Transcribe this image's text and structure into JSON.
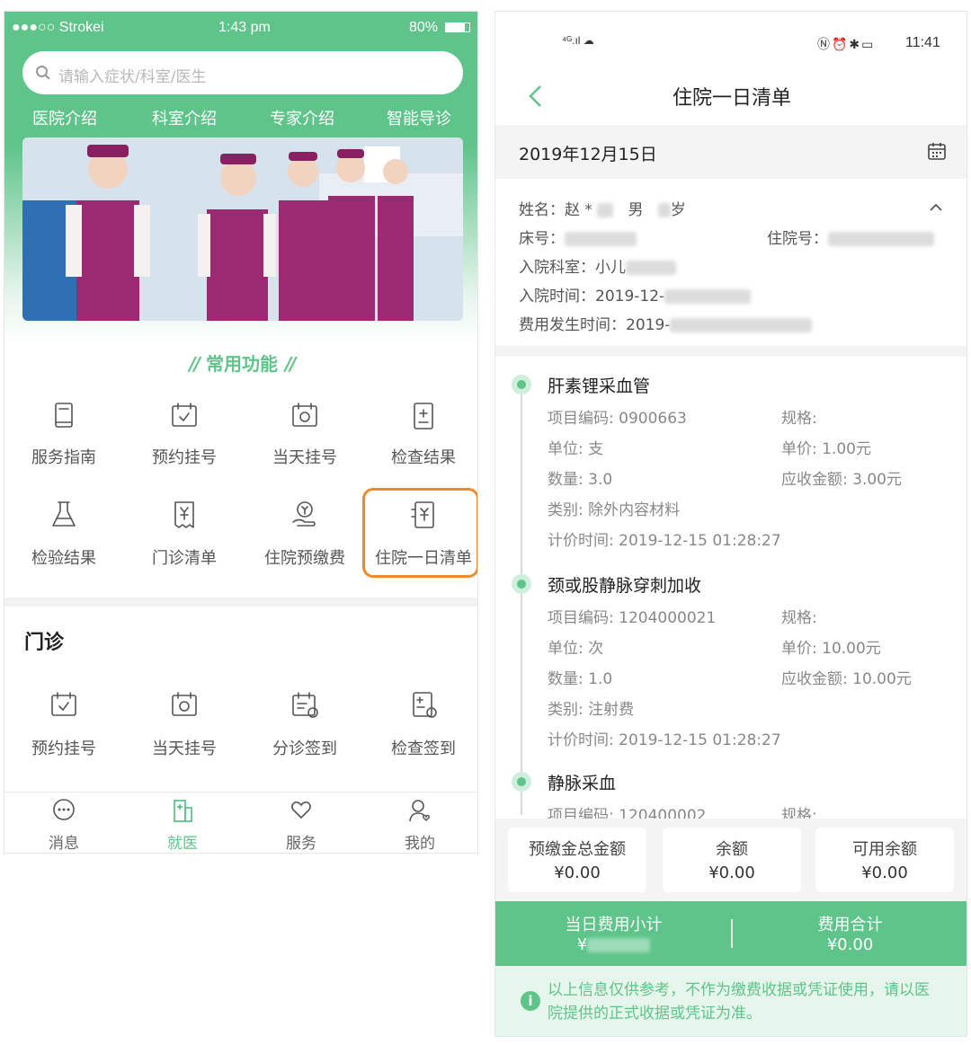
{
  "left_phone": {
    "status": {
      "carrier": "●●●○○ Strokei",
      "time": "1:43 pm",
      "battery": "80%"
    },
    "search": {
      "placeholder": "请输入症状/科室/医生"
    },
    "tabs": [
      "医院介绍",
      "科室介绍",
      "专家介绍",
      "智能导诊"
    ],
    "common_title": "常用功能",
    "common_functions": [
      {
        "label": "服务指南",
        "icon": "book-icon"
      },
      {
        "label": "预约挂号",
        "icon": "calendar-check-icon"
      },
      {
        "label": "当天挂号",
        "icon": "calendar-today-icon"
      },
      {
        "label": "检查结果",
        "icon": "report-plus-icon"
      },
      {
        "label": "检验结果",
        "icon": "flask-icon"
      },
      {
        "label": "门诊清单",
        "icon": "receipt-yen-icon"
      },
      {
        "label": "住院预缴费",
        "icon": "hand-coin-icon"
      },
      {
        "label": "住院一日清单",
        "icon": "bill-yen-icon"
      }
    ],
    "section_title": "门诊",
    "outpatient": [
      {
        "label": "预约挂号",
        "icon": "calendar-check-icon"
      },
      {
        "label": "当天挂号",
        "icon": "calendar-today-icon"
      },
      {
        "label": "分诊签到",
        "icon": "calendar-sign-icon"
      },
      {
        "label": "检查签到",
        "icon": "report-sign-icon"
      }
    ],
    "tabbar": [
      {
        "label": "消息",
        "icon": "chat-icon",
        "active": false
      },
      {
        "label": "就医",
        "icon": "hospital-icon",
        "active": true
      },
      {
        "label": "服务",
        "icon": "heart-hand-icon",
        "active": false
      },
      {
        "label": "我的",
        "icon": "user-icon",
        "active": false
      }
    ],
    "accent": "#5ec48a",
    "highlight_color": "#f08a2c"
  },
  "right_phone": {
    "status": {
      "time": "11:41"
    },
    "nav": {
      "title": "住院一日清单"
    },
    "date": "2019年12月15日",
    "patient": {
      "name_label": "姓名：",
      "name": "赵 *",
      "gender": "男",
      "age_suffix": "岁",
      "bed_label": "床号：",
      "inpatient_no_label": "住院号：",
      "dept_label": "入院科室：",
      "dept": "小儿",
      "admit_label": "入院时间：",
      "admit_time": "2019-12-",
      "fee_time_label": "费用发生时间：",
      "fee_time": "2019-"
    },
    "items": [
      {
        "name": "肝素锂采血管",
        "code": "项目编码:  0900663",
        "spec": "规格:",
        "unit": "单位:  支",
        "price": "单价:  1.00元",
        "qty": "数量:  3.0",
        "amount": "应收金额:  3.00元",
        "category": "类别:  除外内容材料",
        "time": "计价时间:  2019-12-15 01:28:27"
      },
      {
        "name": "颈或股静脉穿刺加收",
        "code": "项目编码:  1204000021",
        "spec": "规格:",
        "unit": "单位:  次",
        "price": "单价:  10.00元",
        "qty": "数量:  1.0",
        "amount": "应收金额:  10.00元",
        "category": "类别:  注射费",
        "time": "计价时间:  2019-12-15 01:28:27"
      },
      {
        "name": "静脉采血",
        "code": "项目编码:  120400002",
        "spec": "规格:"
      }
    ],
    "cards": [
      {
        "label": "预缴金总金额",
        "value": "¥0.00"
      },
      {
        "label": "余额",
        "value": "¥0.00"
      },
      {
        "label": "可用余额",
        "value": "¥0.00"
      }
    ],
    "totals": {
      "daily_label": "当日费用小计",
      "daily_value": "¥",
      "total_label": "费用合计",
      "total_value": "¥0.00"
    },
    "notice": "以上信息仅供参考，不作为缴费收据或凭证使用，请以医院提供的正式收据或凭证为准。"
  }
}
